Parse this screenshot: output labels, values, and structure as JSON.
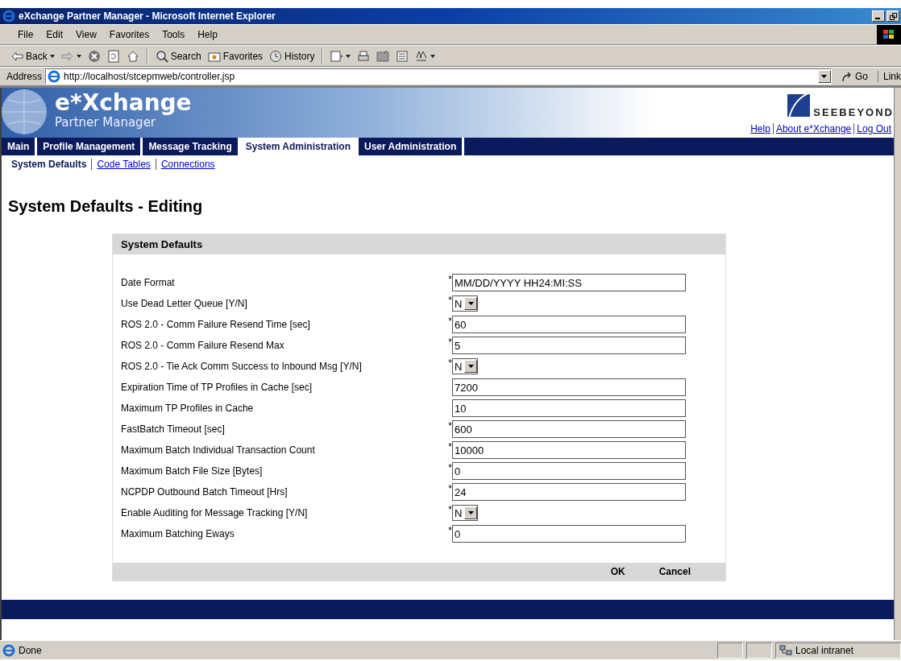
{
  "window": {
    "title": "eXchange Partner Manager - Microsoft Internet Explorer"
  },
  "menu": [
    "File",
    "Edit",
    "View",
    "Favorites",
    "Tools",
    "Help"
  ],
  "toolbar": [
    {
      "kind": "back",
      "label": "Back"
    },
    {
      "kind": "forward"
    },
    {
      "kind": "stop"
    },
    {
      "kind": "refresh"
    },
    {
      "kind": "home"
    },
    {
      "kind": "search",
      "label": "Search"
    },
    {
      "kind": "favorites",
      "label": "Favorites"
    },
    {
      "kind": "history",
      "label": "History"
    },
    {
      "kind": "mail"
    },
    {
      "kind": "print"
    },
    {
      "kind": "edit"
    },
    {
      "kind": "discuss"
    },
    {
      "kind": "fonts"
    }
  ],
  "address": {
    "label": "Address",
    "value": "http://localhost/stcepmweb/controller.jsp",
    "go": "Go",
    "links": "Link"
  },
  "header": {
    "app_name": "e*Xchange",
    "app_subtitle": "Partner Manager",
    "brand": "SEEBEYOND",
    "links": [
      "Help",
      "About e*Xchange",
      "Log Out"
    ]
  },
  "tabs": [
    {
      "label": "Main",
      "selected": false
    },
    {
      "label": "Profile Management",
      "selected": false
    },
    {
      "label": "Message Tracking",
      "selected": false
    },
    {
      "label": "System Administration",
      "selected": true
    },
    {
      "label": "User Administration",
      "selected": false
    }
  ],
  "subtabs": [
    {
      "label": "System Defaults",
      "selected": true
    },
    {
      "label": "Code Tables",
      "selected": false
    },
    {
      "label": "Connections",
      "selected": false
    }
  ],
  "heading": "System Defaults - Editing",
  "panel": {
    "title": "System Defaults",
    "fields": [
      {
        "label": "Date Format",
        "required": true,
        "kind": "text",
        "value": "MM/DD/YYYY HH24:MI:SS"
      },
      {
        "label": "Use Dead Letter Queue [Y/N]",
        "required": true,
        "kind": "select",
        "value": "N"
      },
      {
        "label": "ROS 2.0 - Comm Failure Resend Time [sec]",
        "required": true,
        "kind": "text",
        "value": "60"
      },
      {
        "label": "ROS 2.0 - Comm Failure Resend Max",
        "required": true,
        "kind": "text",
        "value": "5"
      },
      {
        "label": "ROS 2.0 - Tie Ack Comm Success to Inbound Msg [Y/N]",
        "required": true,
        "kind": "select",
        "value": "N"
      },
      {
        "label": "Expiration Time of TP Profiles in Cache [sec]",
        "required": false,
        "kind": "text",
        "value": "7200"
      },
      {
        "label": "Maximum TP Profiles in Cache",
        "required": false,
        "kind": "text",
        "value": "10"
      },
      {
        "label": "FastBatch Timeout [sec]",
        "required": true,
        "kind": "text",
        "value": "600"
      },
      {
        "label": "Maximum Batch Individual Transaction Count",
        "required": true,
        "kind": "text",
        "value": "10000"
      },
      {
        "label": "Maximum Batch File Size [Bytes]",
        "required": true,
        "kind": "text",
        "value": "0"
      },
      {
        "label": "NCPDP Outbound Batch Timeout [Hrs]",
        "required": true,
        "kind": "text",
        "value": "24"
      },
      {
        "label": "Enable Auditing for Message Tracking [Y/N]",
        "required": true,
        "kind": "select",
        "value": "N"
      },
      {
        "label": "Maximum Batching Eways",
        "required": true,
        "kind": "text",
        "value": "0"
      }
    ],
    "required_mark": "*",
    "buttons": [
      "OK",
      "Cancel"
    ]
  },
  "status_bar": {
    "text": "Done",
    "zone": "Local intranet"
  }
}
